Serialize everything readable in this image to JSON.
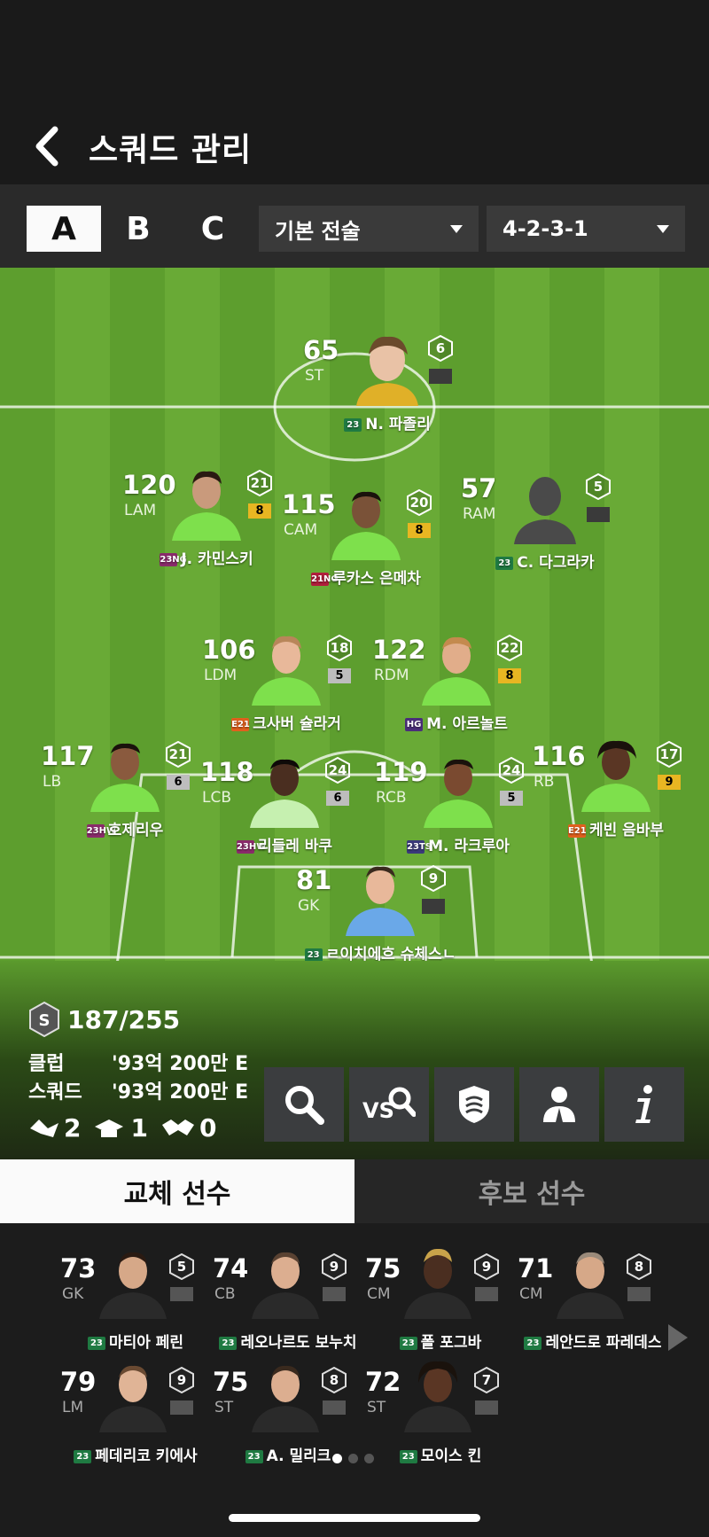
{
  "header": {
    "title": "스쿼드 관리"
  },
  "squad_tabs": [
    "A",
    "B",
    "C"
  ],
  "tactic_dropdown": "기본 전술",
  "formation_dropdown": "4-2-3-1",
  "colors": {
    "accent_active_tab": "#fafafa",
    "grade_yellow": "#e8b622",
    "grade_gray": "#bdbdbd",
    "pitch": "#5d9e2e"
  },
  "players": [
    {
      "ovr": "65",
      "pos": "ST",
      "lvl": "6",
      "grade": "",
      "season": "23",
      "name": "N. 파졸리"
    },
    {
      "ovr": "120",
      "pos": "LAM",
      "lvl": "21",
      "grade": "8",
      "season": "23NG",
      "name": "J. 카민스키"
    },
    {
      "ovr": "115",
      "pos": "CAM",
      "lvl": "20",
      "grade": "8",
      "season": "21NG",
      "name": "루카스 은메차"
    },
    {
      "ovr": "57",
      "pos": "RAM",
      "lvl": "5",
      "grade": "",
      "season": "23",
      "name": "C. 다그라카"
    },
    {
      "ovr": "106",
      "pos": "LDM",
      "lvl": "18",
      "grade": "5",
      "season": "E21",
      "name": "크사버 슐라거"
    },
    {
      "ovr": "122",
      "pos": "RDM",
      "lvl": "22",
      "grade": "8",
      "season": "HG",
      "name": "M. 아르놀트"
    },
    {
      "ovr": "117",
      "pos": "LB",
      "lvl": "21",
      "grade": "6",
      "season": "23HW",
      "name": "호제리우"
    },
    {
      "ovr": "118",
      "pos": "LCB",
      "lvl": "24",
      "grade": "6",
      "season": "23HW",
      "name": "리들레 바쿠"
    },
    {
      "ovr": "119",
      "pos": "RCB",
      "lvl": "24",
      "grade": "5",
      "season": "23TS",
      "name": "M. 라크루아"
    },
    {
      "ovr": "116",
      "pos": "RB",
      "lvl": "17",
      "grade": "9",
      "season": "E21",
      "name": "케빈 음바부"
    },
    {
      "ovr": "81",
      "pos": "GK",
      "lvl": "9",
      "grade": "",
      "season": "23",
      "name": "ㄹ이치에흐 슈체스ㄴ"
    }
  ],
  "team_info": {
    "cost": "187/255",
    "club_label": "클럽",
    "club_value": "'93억 200만 E",
    "squad_label": "스쿼드",
    "squad_value": "'93억 200만 E",
    "stat_1": "2",
    "stat_2": "1",
    "stat_3": "0"
  },
  "bench_tabs": [
    "교체 선수",
    "후보 선수"
  ],
  "subs": [
    {
      "ovr": "73",
      "pos": "GK",
      "lvl": "5",
      "season": "23",
      "name": "마티아 페린"
    },
    {
      "ovr": "74",
      "pos": "CB",
      "lvl": "9",
      "season": "23",
      "name": "레오나르도 보누치"
    },
    {
      "ovr": "75",
      "pos": "CM",
      "lvl": "9",
      "season": "23",
      "name": "폴 포그바"
    },
    {
      "ovr": "71",
      "pos": "CM",
      "lvl": "8",
      "season": "23",
      "name": "레안드로 파레데스"
    },
    {
      "ovr": "79",
      "pos": "LM",
      "lvl": "9",
      "season": "23",
      "name": "페데리코 키에사"
    },
    {
      "ovr": "75",
      "pos": "ST",
      "lvl": "8",
      "season": "23",
      "name": "A. 밀리크"
    },
    {
      "ovr": "72",
      "pos": "ST",
      "lvl": "7",
      "season": "23",
      "name": "모이스 킨"
    }
  ]
}
